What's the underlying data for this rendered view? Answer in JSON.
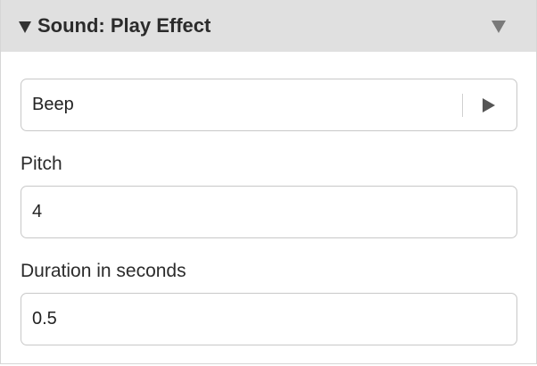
{
  "panel": {
    "title": "Sound: Play Effect"
  },
  "sound": {
    "value": "Beep"
  },
  "pitch": {
    "label": "Pitch",
    "value": "4"
  },
  "duration": {
    "label": "Duration in seconds",
    "value": "0.5"
  },
  "icons": {
    "collapse": "triangle-down-icon",
    "menu": "chevron-down-icon",
    "play": "play-icon"
  }
}
